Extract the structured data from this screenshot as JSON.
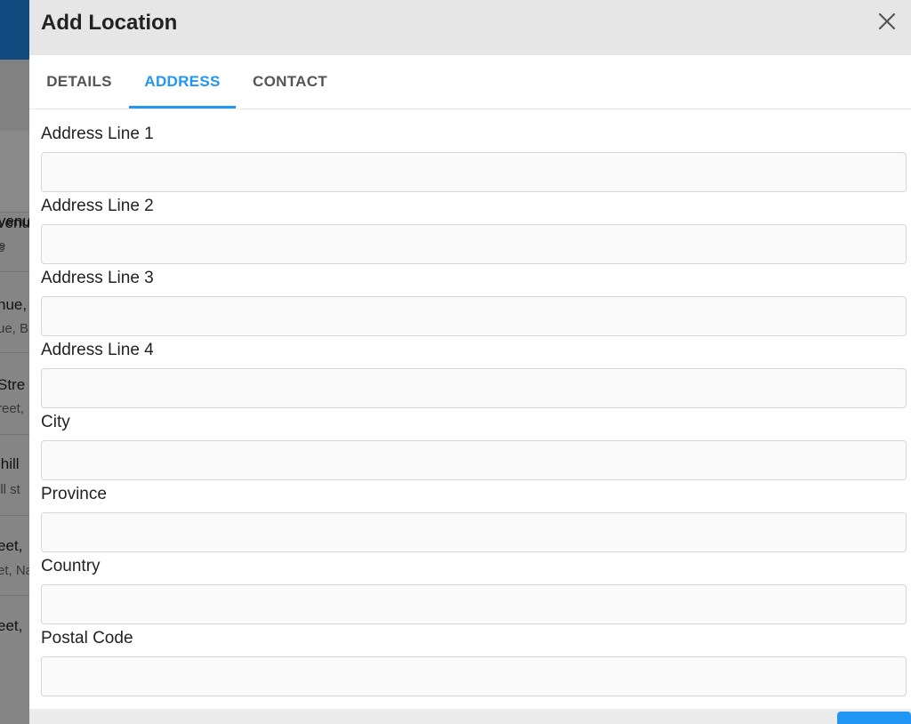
{
  "background": {
    "rows": [
      {
        "line1": "venu",
        "line2": "e"
      },
      {
        "line1": "nue,",
        "line2": "ue, B"
      },
      {
        "line1": "Stre",
        "line2": "reet,"
      },
      {
        "line1": "lhill",
        "line2": "ill st"
      },
      {
        "line1": "eet,",
        "line2": "et, Na"
      },
      {
        "line1": "eet,",
        "line2": ""
      }
    ]
  },
  "dialog": {
    "title": "Add Location",
    "close_icon": "close-icon",
    "tabs": [
      {
        "label": "DETAILS",
        "active": false
      },
      {
        "label": "ADDRESS",
        "active": true
      },
      {
        "label": "CONTACT",
        "active": false
      }
    ],
    "fields": [
      {
        "label": "Address Line 1",
        "value": ""
      },
      {
        "label": "Address Line 2",
        "value": ""
      },
      {
        "label": "Address Line 3",
        "value": ""
      },
      {
        "label": "Address Line 4",
        "value": ""
      },
      {
        "label": "City",
        "value": ""
      },
      {
        "label": "Province",
        "value": ""
      },
      {
        "label": "Country",
        "value": ""
      },
      {
        "label": "Postal Code",
        "value": ""
      }
    ]
  },
  "colors": {
    "accent": "#2196f3",
    "header_bg": "#e6e6e6",
    "topbar": "#1e88e5"
  }
}
